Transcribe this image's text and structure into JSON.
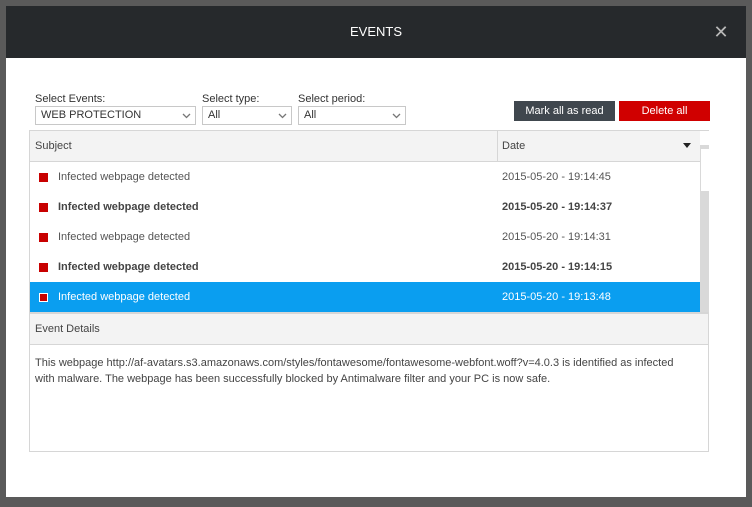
{
  "dialog": {
    "title": "EVENTS",
    "close_symbol": "✕"
  },
  "filters": {
    "events": {
      "label": "Select Events:",
      "value": "WEB PROTECTION"
    },
    "type": {
      "label": "Select type:",
      "value": "All"
    },
    "period": {
      "label": "Select period:",
      "value": "All"
    }
  },
  "actions": {
    "mark_all_read": "Mark all as read",
    "delete_all": "Delete all"
  },
  "table": {
    "columns": {
      "subject": "Subject",
      "date": "Date"
    },
    "rows": [
      {
        "subject": "Infected webpage detected",
        "date": "2015-05-20 - 19:14:45",
        "unread": false,
        "selected": false
      },
      {
        "subject": "Infected webpage detected",
        "date": "2015-05-20 - 19:14:37",
        "unread": true,
        "selected": false
      },
      {
        "subject": "Infected webpage detected",
        "date": "2015-05-20 - 19:14:31",
        "unread": false,
        "selected": false
      },
      {
        "subject": "Infected webpage detected",
        "date": "2015-05-20 - 19:14:15",
        "unread": true,
        "selected": false
      },
      {
        "subject": "Infected webpage detected",
        "date": "2015-05-20 - 19:13:48",
        "unread": false,
        "selected": true
      }
    ]
  },
  "details": {
    "header": "Event Details",
    "line1": "This webpage http://af-avatars.s3.amazonaws.com/styles/fontawesome/fontawesome-webfont.woff?v=4.0.3 is identified as infected",
    "line2": "with malware. The webpage has been successfully blocked by Antimalware filter and your PC is now safe."
  },
  "colors": {
    "titlebar": "#26292c",
    "accent_selected": "#0a9ef0",
    "danger": "#d00000",
    "event_marker": "#c80000"
  },
  "icons": {
    "close": "close-icon",
    "dropdown": "chevron-down-icon",
    "sort": "sort-desc-icon",
    "event_marker": "infection-marker-icon"
  }
}
